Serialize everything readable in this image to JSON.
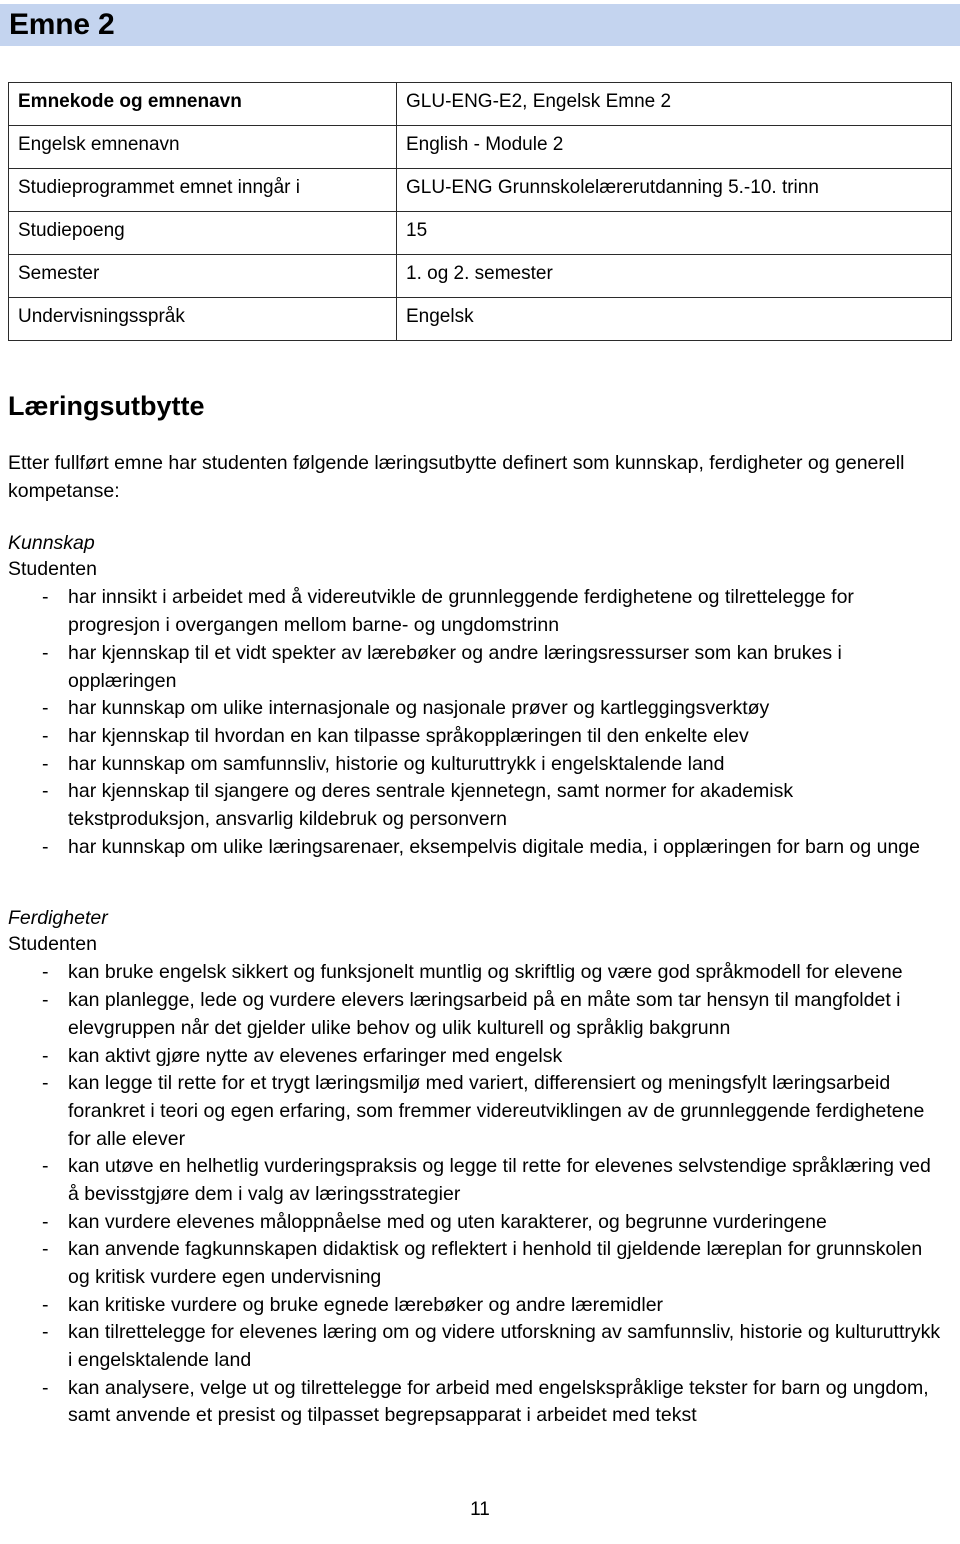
{
  "document": {
    "title_band": {
      "heading": "Emne 2"
    },
    "page_number": "11"
  },
  "info_table": {
    "rows": [
      {
        "label": "Emnekode og emnenavn",
        "value": "GLU-ENG-E2, Engelsk Emne 2"
      },
      {
        "label": "Engelsk emnenavn",
        "value": "English - Module 2"
      },
      {
        "label": "Studieprogrammet emnet inngår i",
        "value": "GLU-ENG Grunnskolelærerutdanning 5.-10. trinn"
      },
      {
        "label": "Studiepoeng",
        "value": "15"
      },
      {
        "label": "Semester",
        "value": "1. og 2. semester"
      },
      {
        "label": "Undervisningsspråk",
        "value": "Engelsk"
      }
    ]
  },
  "learning_outcomes": {
    "heading": "Læringsutbytte",
    "intro": "Etter fullført emne har studenten følgende læringsutbytte definert som kunnskap, ferdigheter og generell kompetanse:",
    "knowledge": {
      "category": "Kunnskap",
      "subject": "Studenten",
      "marker": "-",
      "items": [
        "har innsikt i arbeidet med å videreutvikle de grunnleggende ferdighetene og tilrettelegge for progresjon i overgangen mellom barne- og ungdomstrinn",
        "har kjennskap til et vidt spekter av lærebøker og andre læringsressurser som kan brukes i opplæringen",
        "har kunnskap om ulike internasjonale og nasjonale prøver og kartleggingsverktøy",
        "har kjennskap til hvordan en kan tilpasse språkopplæringen til den enkelte elev",
        "har kunnskap om samfunnsliv, historie og kulturuttrykk i engelsktalende land",
        "har kjennskap til sjangere og deres sentrale kjennetegn, samt normer for akademisk tekstproduksjon, ansvarlig kildebruk og personvern",
        "har kunnskap om ulike læringsarenaer, eksempelvis digitale media, i opplæringen for barn og unge"
      ]
    },
    "skills": {
      "category": "Ferdigheter",
      "subject": "Studenten",
      "marker": "-",
      "items": [
        "kan bruke engelsk sikkert og funksjonelt muntlig og skriftlig og være god språkmodell for elevene",
        "kan planlegge, lede og vurdere elevers læringsarbeid på en måte som tar hensyn til mangfoldet i elevgruppen når det gjelder ulike behov og ulik kulturell og språklig bakgrunn",
        "kan aktivt gjøre nytte av elevenes erfaringer med engelsk",
        "kan legge til rette for et trygt læringsmiljø med variert, differensiert og meningsfylt læringsarbeid forankret i teori og egen erfaring, som fremmer videreutviklingen av de grunnleggende ferdighetene for alle elever",
        "kan utøve en helhetlig vurderingspraksis og legge til rette for elevenes selvstendige språklæring ved å bevisstgjøre dem i valg av læringsstrategier",
        "kan vurdere elevenes måloppnåelse med og uten karakterer, og begrunne vurderingene",
        "kan anvende fagkunnskapen didaktisk og reflektert i henhold til gjeldende læreplan for grunnskolen og kritisk vurdere egen undervisning",
        "kan kritiske vurdere og bruke egnede lærebøker og andre læremidler",
        "kan tilrettelegge for elevenes læring om og videre utforskning av samfunnsliv, historie og kulturuttrykk i engelsktalende land",
        "kan analysere, velge ut og tilrettelegge for arbeid med engelskspråklige tekster for barn og ungdom, samt anvende et presist og tilpasset begrepsapparat i arbeidet med tekst"
      ]
    }
  },
  "colors": {
    "title_band_background": "#c4d4ef",
    "text": "#000000",
    "table_border": "#2b2b2b"
  }
}
